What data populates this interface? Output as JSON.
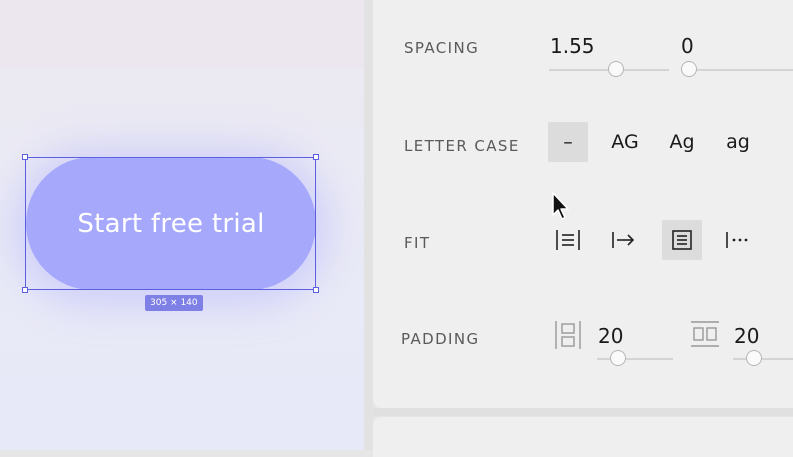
{
  "canvas": {
    "button_text": "Start free trial",
    "size_badge": "305 × 140",
    "button_color": "#a6a8fc",
    "selection_color": "#5b5fe0"
  },
  "inspector": {
    "spacing": {
      "label": "SPACING",
      "value_a": "1.55",
      "value_b": "0"
    },
    "letter_case": {
      "label": "LETTER CASE",
      "options": [
        "–",
        "AG",
        "Ag",
        "ag"
      ],
      "selected": "–"
    },
    "fit": {
      "label": "FIT",
      "options": [
        "align-justify-icon",
        "arrow-right-bar-icon",
        "text-block-icon",
        "ellipsis-bar-icon"
      ],
      "selected": "text-block-icon"
    },
    "padding": {
      "label": "PADDING",
      "value_vertical": "20",
      "value_horizontal": "20"
    }
  }
}
